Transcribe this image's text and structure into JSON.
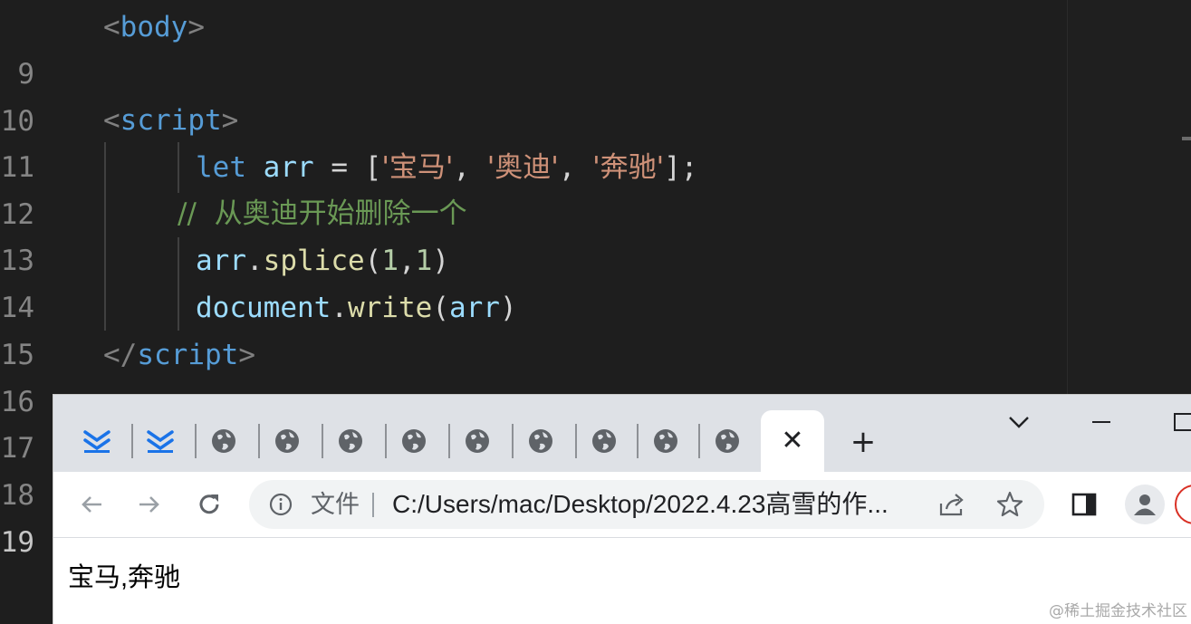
{
  "editor": {
    "line_numbers": [
      "9",
      "10",
      "11",
      "12",
      "13",
      "14",
      "15",
      "16",
      "17",
      "18",
      "19"
    ],
    "line9": {
      "open": "<",
      "tag": "body",
      "close": ">"
    },
    "line11": {
      "open": "<",
      "tag": "script",
      "close": ">"
    },
    "line12": {
      "kw": "let",
      "var": "arr",
      "eq": " = ",
      "lb": "[",
      "s1": "'宝马'",
      "c1": ", ",
      "s2": "'奥迪'",
      "c2": ", ",
      "s3": "'奔驰'",
      "rb": "];"
    },
    "line13": {
      "comment": "//  从奥迪开始删除一个"
    },
    "line14": {
      "obj": "arr",
      "dot": ".",
      "fn": "splice",
      "lp": "(",
      "n1": "1",
      "comma": ",",
      "n2": "1",
      "rp": ")"
    },
    "line15": {
      "obj": "document",
      "dot": ".",
      "fn": "write",
      "lp": "(",
      "arg": "arr",
      "rp": ")"
    },
    "line16": {
      "open": "</",
      "tag": "script",
      "close": ">"
    }
  },
  "browser": {
    "tab_close_glyph": "✕",
    "new_tab_glyph": "+",
    "omnibox": {
      "security_label": "文件",
      "url": "C:/Users/mac/Desktop/2022.4.23高雪的作..."
    },
    "content": "宝马,奔驰"
  },
  "watermark": "@稀土掘金技术社区",
  "colors": {
    "editor_bg": "#1e1e1e",
    "keyword": "#569cd6",
    "string": "#ce9178",
    "comment": "#6a9955",
    "function": "#dcdcaa",
    "variable": "#9cdcfe",
    "tab_icon_blue": "#1a73e8"
  }
}
